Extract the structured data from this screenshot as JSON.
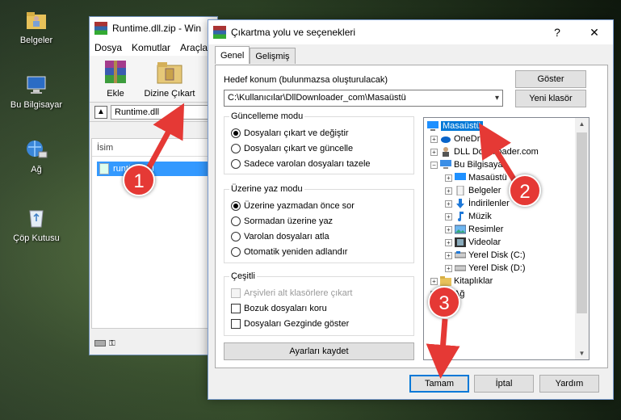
{
  "desktop": {
    "icons": [
      {
        "label": "Belgeler",
        "icon": "folder-user-icon"
      },
      {
        "label": "Bu Bilgisayar",
        "icon": "computer-icon"
      },
      {
        "label": "Ağ",
        "icon": "network-icon"
      },
      {
        "label": "Çöp Kutusu",
        "icon": "recycle-bin-icon"
      }
    ]
  },
  "winrar": {
    "title": "Runtime.dll.zip - Win",
    "menu": [
      "Dosya",
      "Komutlar",
      "Araçla"
    ],
    "tools": [
      {
        "label": "Ekle",
        "icon": "add-archive-icon"
      },
      {
        "label": "Dizine Çıkart",
        "icon": "extract-to-icon"
      }
    ],
    "path": "Runtime.dll",
    "column": "İsim",
    "file": "runtime.dll"
  },
  "dialog": {
    "title": "Çıkartma yolu ve seçenekleri",
    "help": "?",
    "close": "✕",
    "tabs": [
      "Genel",
      "Gelişmiş"
    ],
    "dest_label": "Hedef konum (bulunmazsa oluşturulacak)",
    "dest_value": "C:\\Kullanıcılar\\DllDownloader_com\\Masaüstü",
    "show_button": "Göster",
    "new_folder_button": "Yeni klasör",
    "update_group": {
      "title": "Güncelleme modu",
      "options": [
        "Dosyaları çıkart ve değiştir",
        "Dosyaları çıkart ve güncelle",
        "Sadece varolan dosyaları tazele"
      ],
      "selected": 0
    },
    "overwrite_group": {
      "title": "Üzerine yaz modu",
      "options": [
        "Üzerine yazmadan önce sor",
        "Sormadan üzerine yaz",
        "Varolan dosyaları atla",
        "Otomatik yeniden adlandır"
      ],
      "selected": 0
    },
    "misc_group": {
      "title": "Çeşitli",
      "options": [
        {
          "label": "Arşivleri alt klasörlere çıkart",
          "checked": false,
          "disabled": true
        },
        {
          "label": "Bozuk dosyaları koru",
          "checked": false,
          "disabled": false
        },
        {
          "label": "Dosyaları Gezginde göster",
          "checked": false,
          "disabled": false
        }
      ]
    },
    "save_settings": "Ayarları kaydet",
    "tree": [
      {
        "label": "Masaüstü",
        "icon": "desktop-icon",
        "level": 0,
        "selected": true
      },
      {
        "label": "OneDrive",
        "icon": "cloud-icon",
        "level": 1
      },
      {
        "label": "DLL Downloader.com",
        "icon": "user-icon",
        "level": 1
      },
      {
        "label": "Bu Bilgisayar",
        "icon": "computer-icon",
        "level": 1
      },
      {
        "label": "Masaüstü",
        "icon": "desktop-icon",
        "level": 2
      },
      {
        "label": "Belgeler",
        "icon": "document-icon",
        "level": 2
      },
      {
        "label": "İndirilenler",
        "icon": "download-icon",
        "level": 2
      },
      {
        "label": "Müzik",
        "icon": "music-icon",
        "level": 2
      },
      {
        "label": "Resimler",
        "icon": "pictures-icon",
        "level": 2
      },
      {
        "label": "Videolar",
        "icon": "video-icon",
        "level": 2
      },
      {
        "label": "Yerel Disk (C:)",
        "icon": "drive-icon",
        "level": 2
      },
      {
        "label": "Yerel Disk (D:)",
        "icon": "drive-icon",
        "level": 2
      },
      {
        "label": "Kitaplıklar",
        "icon": "library-icon",
        "level": 1
      },
      {
        "label": "Ağ",
        "icon": "network-icon",
        "level": 1
      }
    ],
    "ok_button": "Tamam",
    "cancel_button": "İptal",
    "help_button": "Yardım"
  },
  "annotations": {
    "step1": "1",
    "step2": "2",
    "step3": "3",
    "color": "#e53935"
  }
}
